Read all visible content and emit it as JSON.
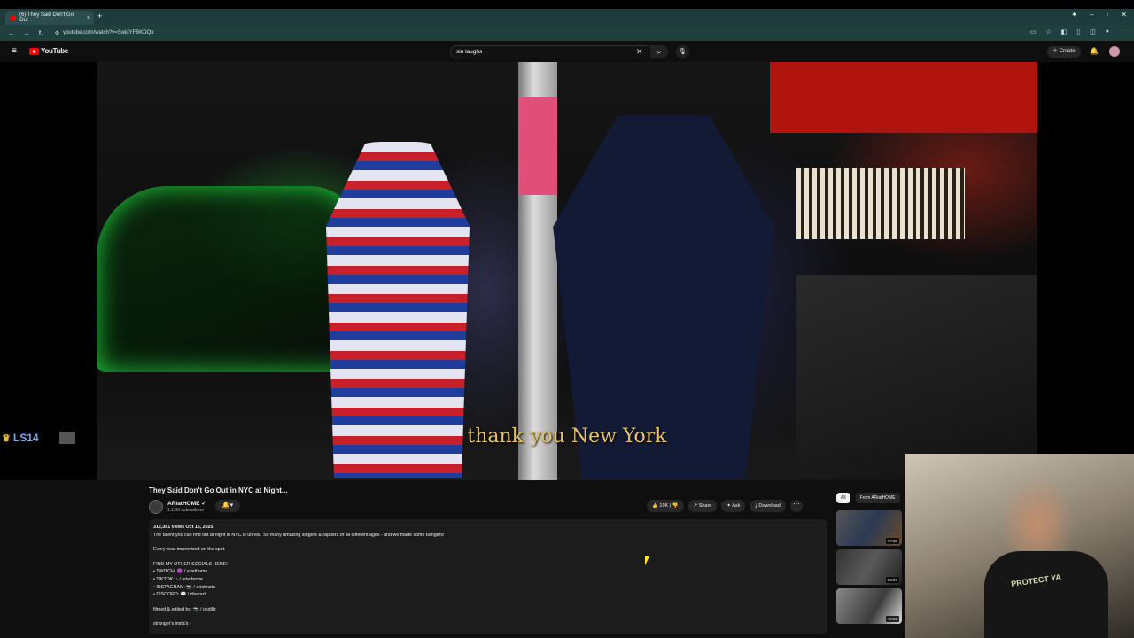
{
  "browser": {
    "tab_title": "(6) They Said Don't Go Out",
    "url": "youtube.com/watch?v=SwidYFBKDQo"
  },
  "youtube": {
    "logo_text": "YouTube",
    "search_value": "sin laughs",
    "create_label": "Create"
  },
  "video": {
    "caption": "thank you New York",
    "overlay_text": "LS14"
  },
  "meta": {
    "title": "They Said Don't Go Out in NYC at Night...",
    "channel_name": "ARiatHOME",
    "subscribers": "1.13M subscribers",
    "likes": "19K",
    "share_label": "Share",
    "ask_label": "Ask",
    "download_label": "Download",
    "stats": "312,381 views  Oct 15, 2025",
    "desc_line1": "The talent you can find out at night in NYC is unreal. So many amazing singers & rappers of all different ages - and we made some bangers!",
    "desc_line2": "Every beat improvised on the spot.",
    "desc_line3": "FIND MY OTHER SOCIALS HERE!",
    "twitch": "• TWITCH: 🟣 / ariathome",
    "tiktok": "• TIKTOK: ♪ / ariathome",
    "instagram": "• INSTAGRAM: 📷 / ariatinsta",
    "discord": "• DISCORD: 💬 / discord",
    "filmed": "filmed & edited by: 📷 / okdillz",
    "stranger": "stranger's insta's -"
  },
  "sidebar": {
    "chip_all": "All",
    "chip_from": "From ARiatHOME",
    "durations": [
      "17:28",
      "53:27",
      "40:22"
    ]
  },
  "webcam": {
    "shirt_text": "PROTECT YA"
  }
}
